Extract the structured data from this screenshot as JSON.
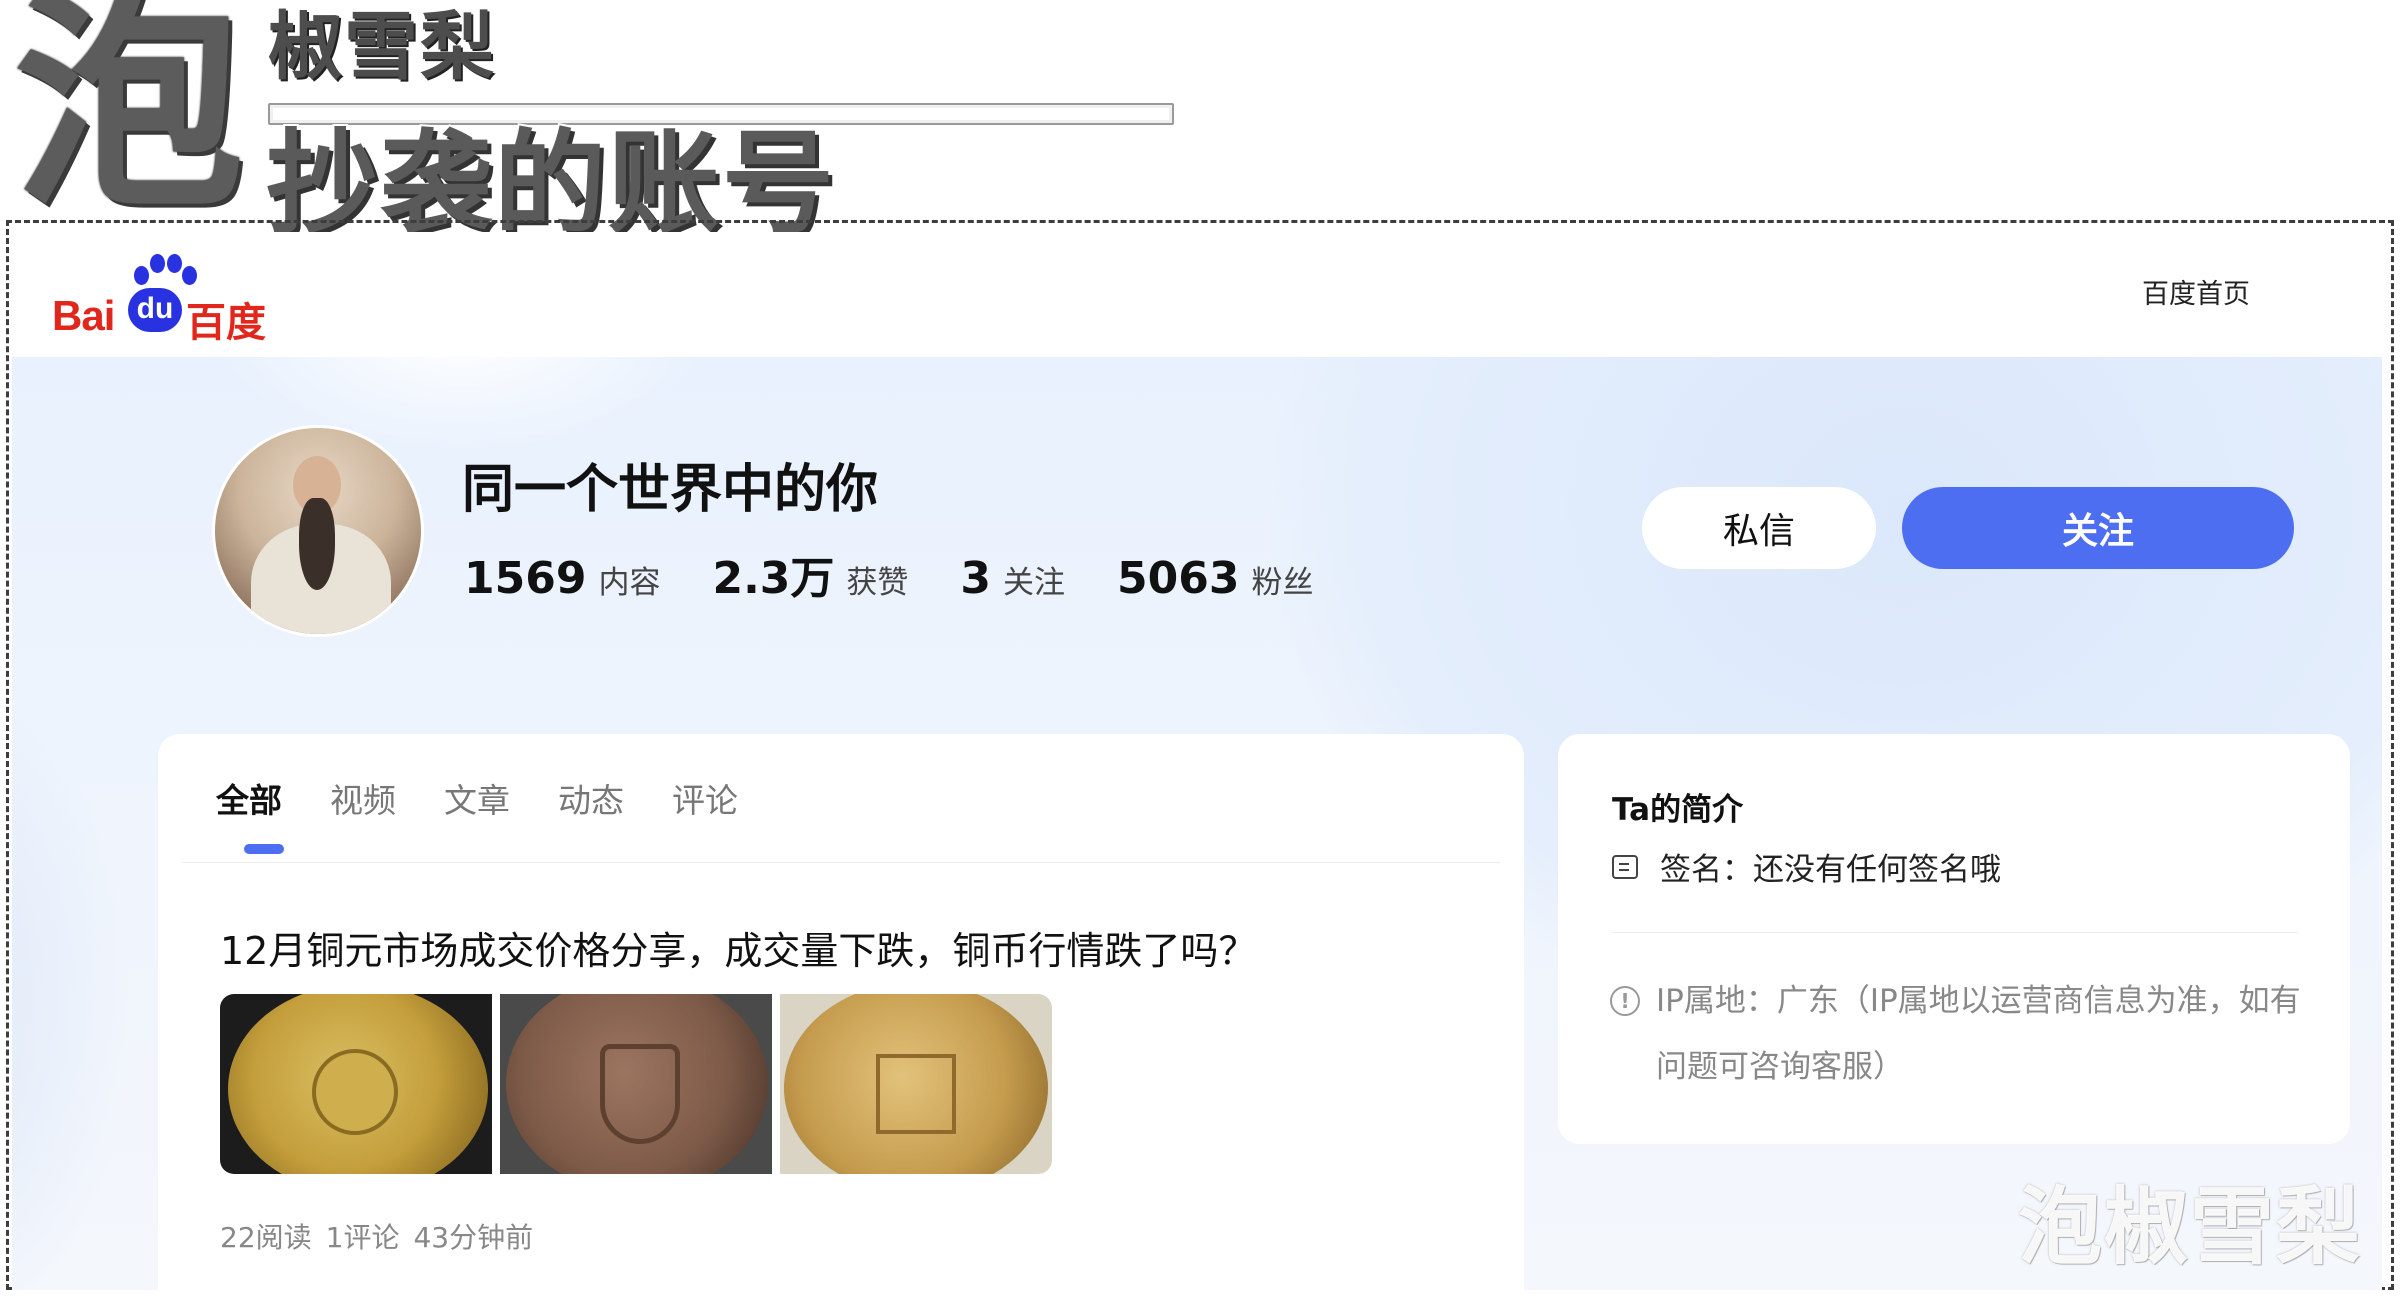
{
  "overlay": {
    "big_char": "泡",
    "title": "椒雪梨",
    "subtitle": "抄袭的账号",
    "watermark": "泡椒雪梨"
  },
  "nav": {
    "logo_bai": "Bai",
    "logo_du": "du",
    "logo_cn": "百度",
    "home_link": "百度首页"
  },
  "profile": {
    "username": "同一个世界中的你",
    "stats": [
      {
        "num": "1569",
        "label": "内容"
      },
      {
        "num": "2.3万",
        "label": "获赞"
      },
      {
        "num": "3",
        "label": "关注"
      },
      {
        "num": "5063",
        "label": "粉丝"
      }
    ],
    "message_button": "私信",
    "follow_button": "关注"
  },
  "tabs": [
    {
      "label": "全部",
      "active": true
    },
    {
      "label": "视频",
      "active": false
    },
    {
      "label": "文章",
      "active": false
    },
    {
      "label": "动态",
      "active": false
    },
    {
      "label": "评论",
      "active": false
    }
  ],
  "post": {
    "title": "12月铜元市场成交价格分享，成交量下跌，铜币行情跌了吗？",
    "meta": [
      "22阅读",
      "1评论",
      "43分钟前"
    ]
  },
  "sidebar": {
    "title": "Ta的简介",
    "signature": "签名：还没有任何签名哦",
    "ip": "IP属地：广东（IP属地以运营商信息为准，如有问题可咨询客服）"
  },
  "colors": {
    "brand_blue": "#4e6ef2",
    "logo_red": "#e1261c",
    "logo_blue": "#2932e1"
  }
}
